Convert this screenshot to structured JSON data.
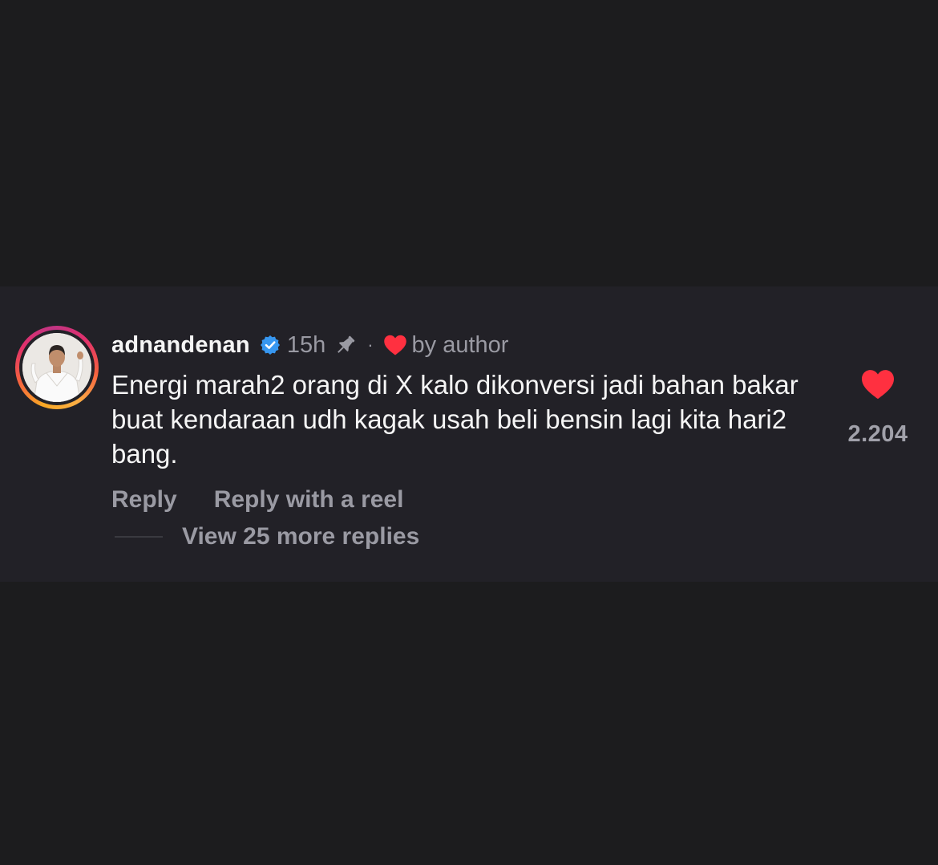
{
  "comment": {
    "username": "adnandenan",
    "time": "15h",
    "dot": "·",
    "by_author": "by author",
    "text": "Energi marah2 orang di X kalo dikonversi jadi bahan bakar buat kendaraan udh kagak usah beli bensin lagi kita hari2 bang.",
    "like_count": "2.204",
    "actions": {
      "reply": "Reply",
      "reply_reel": "Reply with a reel"
    },
    "view_replies": "View 25 more replies"
  },
  "icons": {
    "verified": "verified-badge-icon",
    "pin": "pin-icon",
    "author_heart": "heart-icon",
    "like": "heart-icon"
  },
  "colors": {
    "background": "#1c1c1e",
    "card": "#222127",
    "verified_blue": "#3797f0",
    "heart_red": "#ff3040",
    "muted_text": "#9a9aa3"
  }
}
